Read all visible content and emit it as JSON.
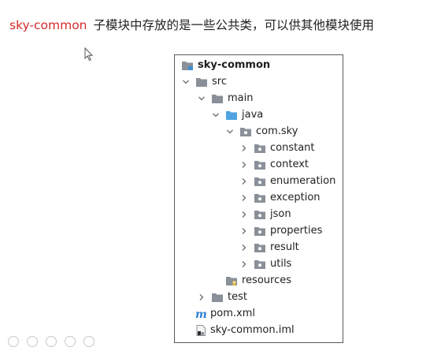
{
  "caption": {
    "module_name": "sky-common",
    "description": "子模块中存放的是一些公共类，可以供其他模块使用"
  },
  "tree": {
    "root": {
      "label": "sky-common"
    },
    "src": {
      "label": "src"
    },
    "main": {
      "label": "main"
    },
    "java": {
      "label": "java"
    },
    "package": {
      "label": "com.sky"
    },
    "subpackages": [
      {
        "label": "constant"
      },
      {
        "label": "context"
      },
      {
        "label": "enumeration"
      },
      {
        "label": "exception"
      },
      {
        "label": "json"
      },
      {
        "label": "properties"
      },
      {
        "label": "result"
      },
      {
        "label": "utils"
      }
    ],
    "resources": {
      "label": "resources"
    },
    "test": {
      "label": "test"
    },
    "pom": {
      "label": "pom.xml"
    },
    "iml": {
      "label": "sky-common.iml"
    }
  },
  "icons": {
    "module": "module-folder-icon",
    "folder": "folder-icon",
    "source_folder": "source-folder-icon",
    "package": "package-icon",
    "resources_folder": "resources-folder-icon",
    "maven": "maven-icon",
    "iml": "iml-file-icon",
    "expanded": "chevron-down-icon",
    "collapsed": "chevron-right-icon"
  },
  "colors": {
    "module_name": "#d62b2b",
    "folder_gray": "#8a9099",
    "source_folder_blue": "#4fa3e0",
    "maven_blue": "#2d7fd3"
  }
}
